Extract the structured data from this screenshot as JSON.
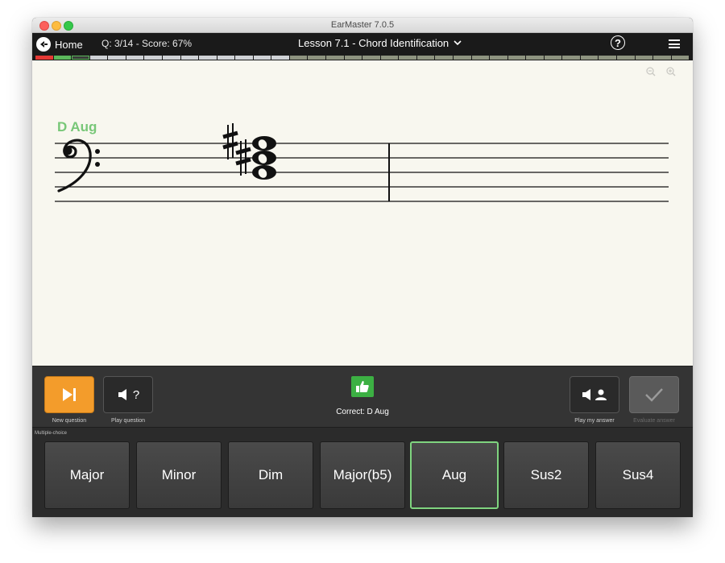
{
  "window": {
    "title": "EarMaster 7.0.5"
  },
  "appbar": {
    "home_label": "Home",
    "question_score": "Q: 3/14 - Score: 67%",
    "lesson_title": "Lesson 7.1 - Chord Identification",
    "help_symbol": "?"
  },
  "progress": {
    "segments": [
      "red",
      "green",
      "green-outline",
      "gray",
      "gray",
      "gray",
      "gray",
      "gray",
      "gray",
      "gray",
      "gray",
      "gray",
      "gray",
      "gray",
      "olive",
      "olive",
      "olive",
      "olive",
      "olive",
      "olive",
      "olive",
      "olive",
      "olive",
      "olive",
      "olive",
      "olive",
      "olive",
      "olive",
      "olive",
      "olive",
      "olive",
      "olive",
      "olive",
      "olive",
      "olive",
      "olive"
    ],
    "colors": {
      "red": "#e53935",
      "green": "#5cb85c",
      "gray": "#cfd2d6",
      "olive": "#8e9480"
    }
  },
  "score": {
    "chord_name": "D Aug",
    "chord_name_color": "#78c778",
    "clef": "bass",
    "notes": [
      "D",
      "F#",
      "A#"
    ],
    "accidentals": [
      "sharp",
      "sharp"
    ]
  },
  "toolbar": {
    "new_question_label": "New question",
    "play_question_label": "Play question",
    "play_question_symbol": "?",
    "feedback_text": "Correct: D Aug",
    "play_answer_label": "Play my answer",
    "evaluate_label": "Evaluate answer",
    "accent_orange": "#f39c2b"
  },
  "answers": {
    "section_label": "Multiple-choice",
    "options": [
      "Major",
      "Minor",
      "Dim",
      "Major(b5)",
      "Aug",
      "Sus2",
      "Sus4"
    ],
    "selected": "Aug"
  }
}
